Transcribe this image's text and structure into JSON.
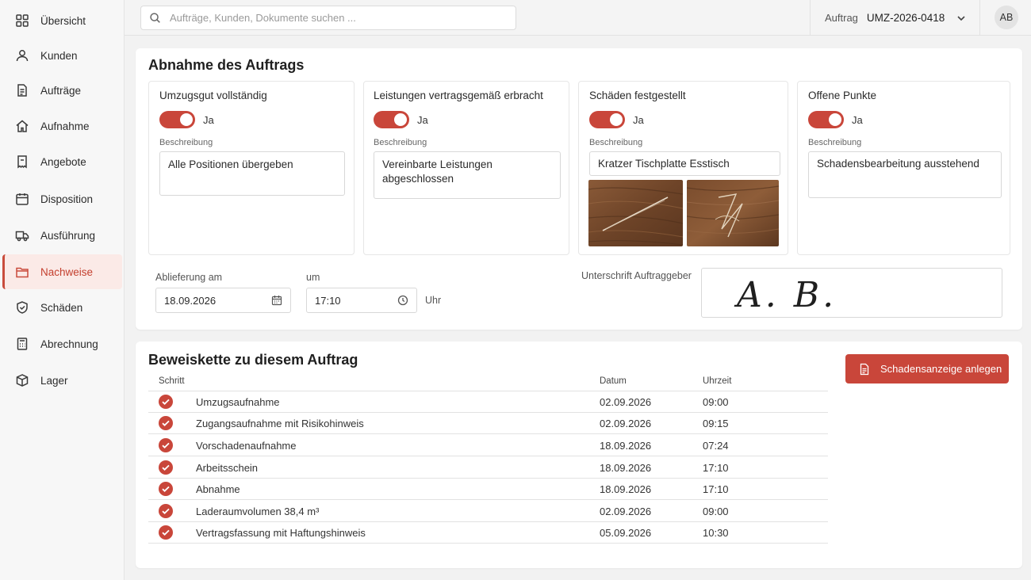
{
  "nav": {
    "items": [
      {
        "label": "Übersicht",
        "icon": "grid-icon"
      },
      {
        "label": "Kunden",
        "icon": "user-icon"
      },
      {
        "label": "Aufträge",
        "icon": "document-icon"
      },
      {
        "label": "Aufnahme",
        "icon": "home-icon"
      },
      {
        "label": "Angebote",
        "icon": "offer-icon"
      },
      {
        "label": "Disposition",
        "icon": "calendar-icon"
      },
      {
        "label": "Ausführung",
        "icon": "truck-icon"
      },
      {
        "label": "Nachweise",
        "icon": "folder-icon",
        "active": true
      },
      {
        "label": "Schäden",
        "icon": "shield-icon"
      },
      {
        "label": "Abrechnung",
        "icon": "calculator-icon"
      },
      {
        "label": "Lager",
        "icon": "box-icon"
      }
    ]
  },
  "topbar": {
    "search_placeholder": "Aufträge, Kunden, Dokumente suchen ...",
    "order_label": "Auftrag",
    "order_value": "UMZ-2026-0418",
    "avatar_initials": "AB"
  },
  "acceptance": {
    "title": "Abnahme des Auftrags",
    "cards": [
      {
        "title": "Umzugsgut vollständig",
        "toggle_label": "Ja",
        "desc_label": "Beschreibung",
        "desc": "Alle Positionen übergeben"
      },
      {
        "title": "Leistungen vertragsgemäß erbracht",
        "toggle_label": "Ja",
        "desc_label": "Beschreibung",
        "desc": "Vereinbarte Leistungen abgeschlossen"
      },
      {
        "title": "Schäden festgestellt",
        "toggle_label": "Ja",
        "desc_label": "Beschreibung",
        "desc": "Kratzer Tischplatte Esstisch"
      },
      {
        "title": "Offene Punkte",
        "toggle_label": "Ja",
        "desc_label": "Beschreibung",
        "desc": "Schadensbearbeitung ausstehend"
      }
    ],
    "delivery_label": "Ablieferung am",
    "delivery_date": "18.09.2026",
    "time_label": "um",
    "time_value": "17:10",
    "time_unit": "Uhr",
    "signature_label": "Unterschrift Auftraggeber",
    "signature_text": "A. B."
  },
  "evidence": {
    "title": "Beweiskette zu diesem Auftrag",
    "columns": {
      "step": "Schritt",
      "date": "Datum",
      "time": "Uhrzeit"
    },
    "rows": [
      {
        "step": "Umzugsaufnahme",
        "date": "02.09.2026",
        "time": "09:00"
      },
      {
        "step": "Zugangsaufnahme mit Risikohinweis",
        "date": "02.09.2026",
        "time": "09:15"
      },
      {
        "step": "Vorschadenaufnahme",
        "date": "18.09.2026",
        "time": "07:24"
      },
      {
        "step": "Arbeitsschein",
        "date": "18.09.2026",
        "time": "17:10"
      },
      {
        "step": "Abnahme",
        "date": "18.09.2026",
        "time": "17:10"
      },
      {
        "step": "Laderaumvolumen 38,4 m³",
        "date": "02.09.2026",
        "time": "09:00"
      },
      {
        "step": "Vertragsfassung mit Haftungshinweis",
        "date": "05.09.2026",
        "time": "10:30"
      }
    ],
    "create_button": "Schadensanzeige anlegen"
  },
  "colors": {
    "accent": "#c9463a",
    "active_bg": "#fbeae7"
  }
}
